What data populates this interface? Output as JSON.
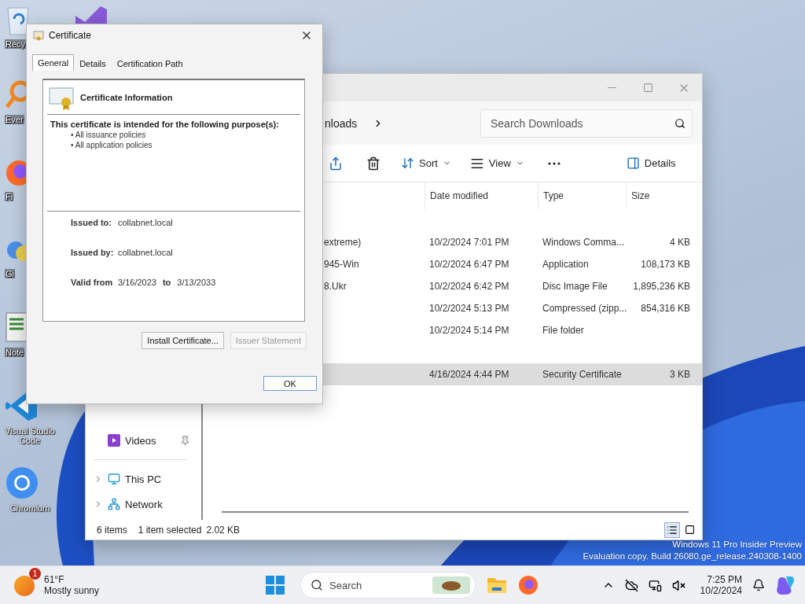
{
  "desktop_icons": [
    {
      "kind": "recycle",
      "label": "Recy"
    },
    {
      "kind": "everything",
      "label": "Ever"
    },
    {
      "kind": "firefox",
      "label": "Fi"
    },
    {
      "kind": "gitbash",
      "label": "Gi"
    },
    {
      "kind": "notepad",
      "label": "Note"
    },
    {
      "kind": "vscode",
      "label": "Visual Studio Code"
    },
    {
      "kind": "chromium",
      "label": "Chromium"
    }
  ],
  "certificate_dialog": {
    "title": "Certificate",
    "tabs": [
      {
        "label": "General",
        "selected": true
      },
      {
        "label": "Details",
        "selected": false
      },
      {
        "label": "Certification Path",
        "selected": false
      }
    ],
    "heading": "Certificate Information",
    "purpose_intro": "This certificate is intended for the following purpose(s):",
    "purposes": [
      "• All issuance policies",
      "• All application policies"
    ],
    "fields": [
      {
        "label": "Issued to:",
        "value": "collabnet.local"
      },
      {
        "label": "Issued by:",
        "value": "collabnet.local"
      }
    ],
    "validity": {
      "label": "Valid from",
      "from": "3/16/2023",
      "to_label": "to",
      "to": "3/13/2033"
    },
    "buttons": [
      {
        "label": "Install Certificate...",
        "disabled": false
      },
      {
        "label": "Issuer Statement",
        "disabled": true
      }
    ],
    "ok_button": "OK"
  },
  "explorer": {
    "breadcrumb": "nloads",
    "search": {
      "placeholder": "Search Downloads"
    },
    "toolbar": {
      "sort": "Sort",
      "view": "View",
      "details": "Details"
    },
    "columns": [
      "Date modified",
      "Type",
      "Size"
    ],
    "rows": [
      {
        "name": "extreme)",
        "date": "10/2/2024 7:01 PM",
        "type": "Windows Comma...",
        "size": "4 KB",
        "selected": false
      },
      {
        "name": "945-Win",
        "date": "10/2/2024 6:47 PM",
        "type": "Application",
        "size": "108,173 KB",
        "selected": false
      },
      {
        "name": "8.Ukr",
        "date": "10/2/2024 6:42 PM",
        "type": "Disc Image File",
        "size": "1,895,236 KB",
        "selected": false
      },
      {
        "date": "10/2/2024 5:13 PM",
        "type": "Compressed (zipp...",
        "size": "854,316 KB",
        "selected": false
      },
      {
        "date": "10/2/2024 5:14 PM",
        "type": "File folder",
        "selected": false
      },
      {
        "date": "4/16/2024 4:44 PM",
        "type": "Security Certificate",
        "size": "3 KB",
        "selected": true,
        "group_start": true
      }
    ],
    "nav": [
      {
        "kind": "pinned",
        "label": "Videos"
      },
      {
        "kind": "expandable",
        "label": "This PC"
      },
      {
        "kind": "expandable",
        "label": "Network"
      }
    ],
    "status": {
      "count": "6 items",
      "selection": "1 item selected",
      "size": "2.02 KB"
    },
    "view_toggles": [
      {
        "kind": "details",
        "selected": true
      },
      {
        "kind": "tiles",
        "selected": false
      }
    ]
  },
  "watermark": [
    "Windows 11 Pro Insider Preview",
    "Evaluation copy. Build 26080.ge_release.240308-1400"
  ],
  "taskbar": {
    "weather": {
      "badge": "1",
      "temperature": "61°F",
      "condition": "Mostly sunny"
    },
    "search": {
      "placeholder": "Search"
    },
    "clock": {
      "time": "7:25 PM",
      "date": "10/2/2024"
    }
  }
}
